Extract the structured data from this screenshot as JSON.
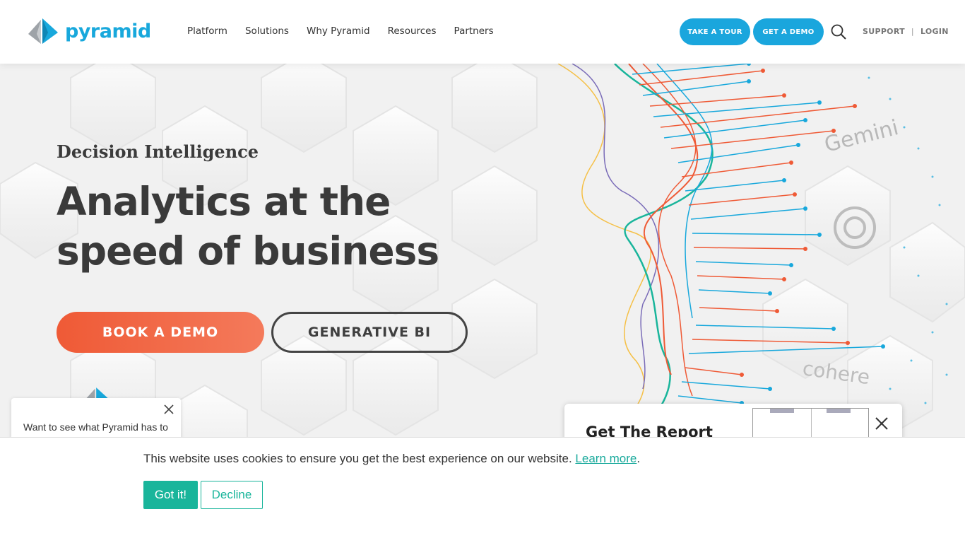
{
  "brand": {
    "name": "pyramid",
    "color": "#18a8dc"
  },
  "nav": {
    "items": [
      "Platform",
      "Solutions",
      "Why Pyramid",
      "Resources",
      "Partners"
    ]
  },
  "header": {
    "tour_label": "TAKE A TOUR",
    "demo_label": "GET A DEMO",
    "support_label": "SUPPORT",
    "separator": "|",
    "login_label": "LOGIN"
  },
  "hero": {
    "eyebrow": "Decision Intelligence",
    "headline_line1": "Analytics at the",
    "headline_line2": "speed of business",
    "book_demo_label": "BOOK A DEMO",
    "generative_bi_label": "GENERATIVE BI",
    "partner_logos": [
      "Gemini",
      "cohere"
    ]
  },
  "chat": {
    "message": "Want to see what Pyramid has to"
  },
  "report_popup": {
    "title": "Get The Report"
  },
  "cookie": {
    "message": "This website uses cookies to ensure you get the best experience on our website.",
    "learn_more": "Learn more",
    "period": ".",
    "accept_label": "Got it!",
    "decline_label": "Decline"
  },
  "colors": {
    "accent_blue": "#1aa6dd",
    "accent_orange": "#ef5a36",
    "cookie_green": "#19b59b"
  }
}
